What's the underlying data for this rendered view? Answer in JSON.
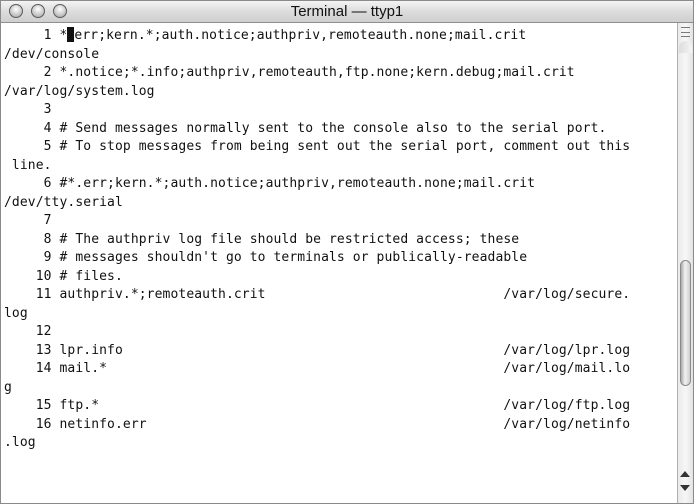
{
  "window": {
    "title": "Terminal — ttyp1"
  },
  "terminal": {
    "lines": [
      {
        "prefix": "     1 *",
        "cursor": true,
        "rest": "err;kern.*;auth.notice;authpriv,remoteauth.none;mail.crit"
      },
      {
        "prefix": "/dev/console"
      },
      {
        "prefix": "     2 *.notice;*.info;authpriv,remoteauth,ftp.none;kern.debug;mail.crit"
      },
      {
        "prefix": "/var/log/system.log"
      },
      {
        "prefix": "     3"
      },
      {
        "prefix": "     4 # Send messages normally sent to the console also to the serial port."
      },
      {
        "prefix": "     5 # To stop messages from being sent out the serial port, comment out this"
      },
      {
        "prefix": " line."
      },
      {
        "prefix": "     6 #*.err;kern.*;auth.notice;authpriv,remoteauth.none;mail.crit"
      },
      {
        "prefix": "/dev/tty.serial"
      },
      {
        "prefix": "     7"
      },
      {
        "prefix": "     8 # The authpriv log file should be restricted access; these"
      },
      {
        "prefix": "     9 # messages shouldn't go to terminals or publically-readable"
      },
      {
        "prefix": "    10 # files."
      },
      {
        "prefix": "    11 authpriv.*;remoteauth.crit                              /var/log/secure."
      },
      {
        "prefix": "log"
      },
      {
        "prefix": "    12"
      },
      {
        "prefix": "    13 lpr.info                                                /var/log/lpr.log"
      },
      {
        "prefix": "    14 mail.*                                                  /var/log/mail.lo"
      },
      {
        "prefix": "g"
      },
      {
        "prefix": "    15 ftp.*                                                   /var/log/ftp.log"
      },
      {
        "prefix": "    16 netinfo.err                                             /var/log/netinfo"
      },
      {
        "prefix": ".log"
      }
    ]
  },
  "scrollbar": {
    "position_fraction": 0.72
  }
}
